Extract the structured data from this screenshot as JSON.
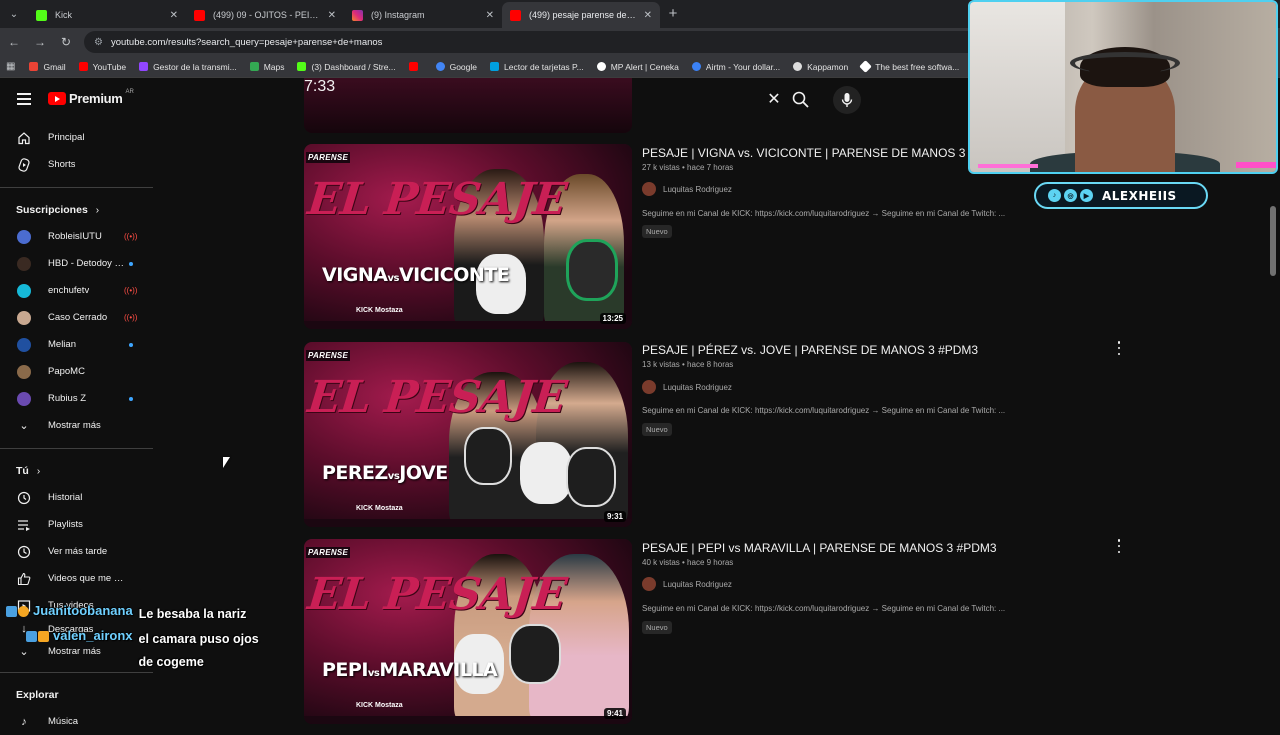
{
  "browser": {
    "tabs": [
      {
        "title": "Kick",
        "color": "#53fc18",
        "active": false
      },
      {
        "title": "(499) 09 - OJITOS - PEIPPER feat. …",
        "color": "#ff0000",
        "active": false
      },
      {
        "title": "(9) Instagram",
        "color": "#e1306c",
        "active": false
      },
      {
        "title": "(499) pesaje parense de manos",
        "color": "#ff0000",
        "active": true
      }
    ],
    "url": "youtube.com/results?search_query=pesaje+parense+de+manos",
    "bookmarks": [
      {
        "label": "Gmail",
        "color": "#ea4335"
      },
      {
        "label": "YouTube",
        "color": "#ff0000"
      },
      {
        "label": "Gestor de la transmi...",
        "color": "#9146ff"
      },
      {
        "label": "Maps",
        "color": "#34a853"
      },
      {
        "label": "(3) Dashboard / Stre...",
        "color": "#53fc18"
      },
      {
        "label": "",
        "color": "#ff0000"
      },
      {
        "label": "Google",
        "color": "#4285f4"
      },
      {
        "label": "Lector de tarjetas P...",
        "color": "#00a0e0"
      },
      {
        "label": "MP Alert | Ceneka",
        "color": "#ffffff"
      },
      {
        "label": "Airtm - Your dollar...",
        "color": "#3b82f6"
      },
      {
        "label": "Kappamon",
        "color": "#dddddd"
      },
      {
        "label": "The best free softwa...",
        "color": "#ffffff"
      },
      {
        "label": "Tr",
        "color": "#cccccc"
      }
    ]
  },
  "youtube": {
    "logo": "Premium",
    "region": "AR",
    "search_query": "pesaje parense de manos"
  },
  "sidebar": {
    "main": [
      {
        "label": "Principal",
        "icon": "home-icon"
      },
      {
        "label": "Shorts",
        "icon": "shorts-icon"
      }
    ],
    "subs_header": "Suscripciones",
    "subscriptions": [
      {
        "label": "RobleisIUTU",
        "color": "#4b6cd0",
        "status": "live"
      },
      {
        "label": "HBD - Detodoy R...",
        "color": "#3a2a22",
        "status": "dot"
      },
      {
        "label": "enchufetv",
        "color": "#16b9d8",
        "status": "live"
      },
      {
        "label": "Caso Cerrado",
        "color": "#c8a890",
        "status": "live"
      },
      {
        "label": "Melian",
        "color": "#2050a0",
        "status": "dot"
      },
      {
        "label": "PapoMC",
        "color": "#8a6a4a",
        "status": ""
      },
      {
        "label": "Rubius Z",
        "color": "#6a4ab0",
        "status": "dot"
      }
    ],
    "show_more_subs": "Mostrar más",
    "you_header": "Tú",
    "you": [
      {
        "label": "Historial",
        "icon": "history-icon"
      },
      {
        "label": "Playlists",
        "icon": "playlists-icon"
      },
      {
        "label": "Ver más tarde",
        "icon": "watch-later-icon"
      },
      {
        "label": "Videos que me gus...",
        "icon": "thumbs-up-icon"
      },
      {
        "label": "Tus videos",
        "icon": "your-videos-icon"
      },
      {
        "label": "Descargas",
        "icon": "download-icon"
      }
    ],
    "show_more_you": "Mostrar más",
    "explore_header": "Explorar",
    "explore": [
      {
        "label": "Música",
        "icon": "music-icon"
      }
    ]
  },
  "results": {
    "top_duration": "7:33",
    "videos": [
      {
        "title": "PESAJE | VIGNA vs. VICICONTE | PARENSE DE MANOS 3 #PD",
        "views": "27 k vistas",
        "age": "hace 7 horas",
        "channel": "Luquitas Rodriguez",
        "description": "Seguime en mi Canal de KICK: https://kick.com/luquitarodriguez → Seguime en mi Canal de Twitch: ...",
        "badge": "Nuevo",
        "duration": "13:25",
        "thumb_vs": "VIGNA",
        "thumb_vs2": "VICICONTE"
      },
      {
        "title": "PESAJE | PÉREZ vs. JOVE | PARENSE DE MANOS 3 #PDM3",
        "views": "13 k vistas",
        "age": "hace 8 horas",
        "channel": "Luquitas Rodriguez",
        "description": "Seguime en mi Canal de KICK: https://kick.com/luquitarodriguez → Seguime en mi Canal de Twitch: ...",
        "badge": "Nuevo",
        "duration": "9:31",
        "thumb_vs": "PEREZ",
        "thumb_vs2": "JOVE"
      },
      {
        "title": "PESAJE | PEPI vs MARAVILLA | PARENSE DE MANOS 3 #PDM3",
        "views": "40 k vistas",
        "age": "hace 9 horas",
        "channel": "Luquitas Rodriguez",
        "description": "Seguime en mi Canal de KICK: https://kick.com/luquitarodriguez → Seguime en mi Canal de Twitch: ...",
        "badge": "Nuevo",
        "duration": "9:41",
        "thumb_vs": "PEPI",
        "thumb_vs2": "MARAVILLA"
      }
    ],
    "thumb_brand": "PARENSE",
    "thumb_title": "EL PESAJE",
    "thumb_vs_word": "vs",
    "thumb_sponsor": "KICK  Mostaza"
  },
  "overlay": {
    "streamer_name": "ALEXHEIIS",
    "chat": [
      {
        "user": "Juanitoobanana",
        "message": "Le besaba la nariz"
      },
      {
        "user": "valen_aironx",
        "message": "el camara puso ojos de cogeme"
      }
    ]
  }
}
